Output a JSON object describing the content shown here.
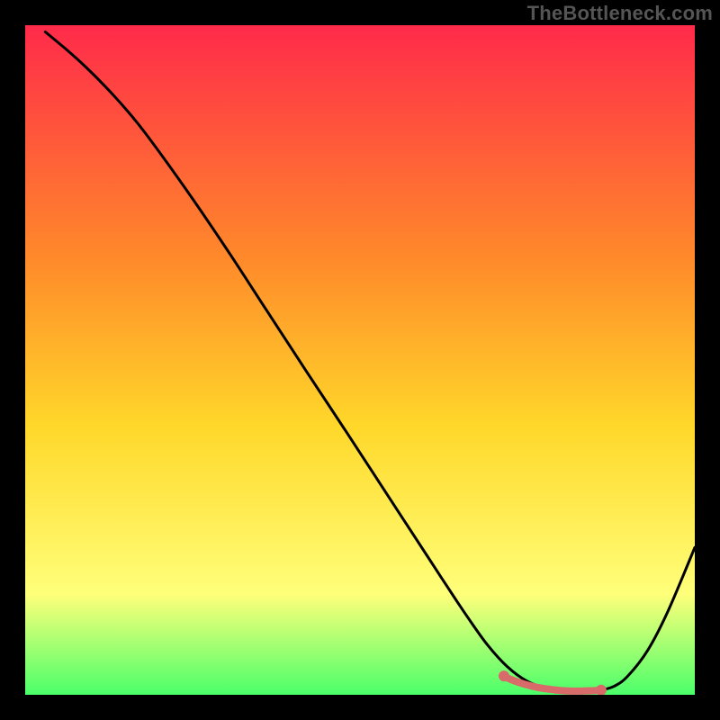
{
  "watermark": "TheBottleneck.com",
  "colors": {
    "bg": "#000000",
    "curve": "#000000",
    "marker": "#d86a6a",
    "grad_top": "#ff2a4a",
    "grad_mid1": "#ff8a2a",
    "grad_mid2": "#ffd82a",
    "grad_mid3": "#ffff7a",
    "grad_bot": "#4aff6a"
  },
  "chart_data": {
    "type": "line",
    "title": "",
    "xlabel": "",
    "ylabel": "",
    "xlim": [
      0,
      100
    ],
    "ylim": [
      0,
      100
    ],
    "x": [
      3,
      6,
      9,
      12,
      15,
      18,
      24,
      30,
      36,
      42,
      48,
      54,
      60,
      63,
      66,
      69,
      72,
      75,
      78,
      80,
      82,
      84,
      86,
      88,
      90,
      93,
      96,
      100
    ],
    "values": [
      99,
      96.5,
      93.8,
      90.8,
      87.5,
      83.8,
      75.5,
      66.7,
      57.5,
      48.3,
      39.2,
      30,
      20.8,
      16.2,
      11.7,
      7.5,
      4.2,
      2,
      0.9,
      0.6,
      0.5,
      0.5,
      0.7,
      1.3,
      2.8,
      6.7,
      12.5,
      22
    ],
    "markers": {
      "x": [
        71.5,
        72.5,
        74.5,
        76.5,
        78.5,
        80.5,
        82.5,
        84.5,
        86.0
      ],
      "values": [
        2.8,
        2.3,
        1.6,
        1.1,
        0.8,
        0.6,
        0.55,
        0.6,
        0.7
      ]
    }
  }
}
